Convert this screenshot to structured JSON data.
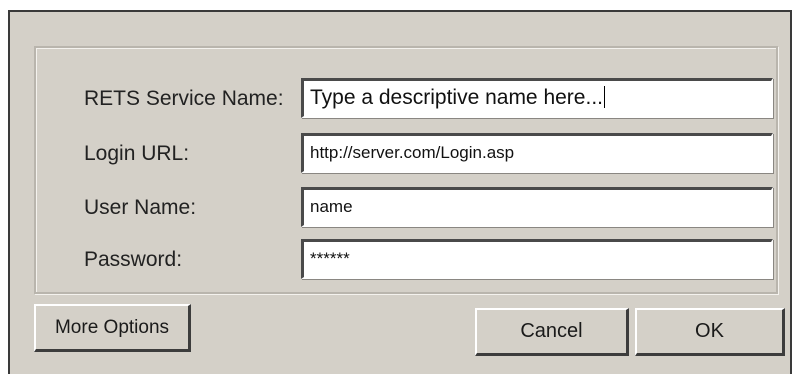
{
  "form": {
    "fields": [
      {
        "label": "RETS Service Name:",
        "value": "Type a descriptive name here..."
      },
      {
        "label": "Login URL:",
        "value": "http://server.com/Login.asp"
      },
      {
        "label": "User Name:",
        "value": "name"
      },
      {
        "label": "Password:",
        "value": "******"
      }
    ]
  },
  "buttons": {
    "more_options": "More Options",
    "cancel": "Cancel",
    "ok": "OK"
  },
  "colors": {
    "dialog_bg": "#d4d0c8",
    "input_bg": "#ffffff"
  }
}
